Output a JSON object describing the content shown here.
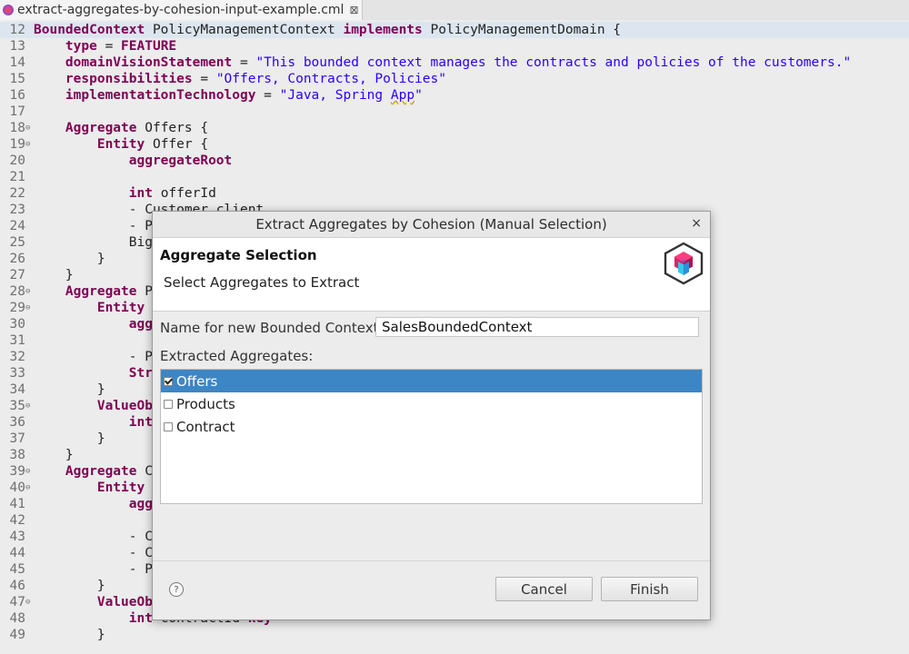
{
  "editor": {
    "tab_title": "extract-aggregates-by-cohesion-input-example.cml",
    "tab_close": "⊠",
    "lines": [
      {
        "n": "12",
        "fold": "",
        "hl": true,
        "parts": [
          [
            "kw",
            "BoundedContext"
          ],
          [
            "",
            " PolicyManagementContext "
          ],
          [
            "kw",
            "implements"
          ],
          [
            "",
            " PolicyManagementDomain {"
          ]
        ]
      },
      {
        "n": "13",
        "fold": "",
        "parts": [
          [
            "",
            "    "
          ],
          [
            "kw",
            "type"
          ],
          [
            "",
            " = "
          ],
          [
            "kw",
            "FEATURE"
          ]
        ]
      },
      {
        "n": "14",
        "fold": "",
        "parts": [
          [
            "",
            "    "
          ],
          [
            "kw",
            "domainVisionStatement"
          ],
          [
            "",
            " = "
          ],
          [
            "str",
            "\"This bounded context manages the contracts and policies of the customers.\""
          ]
        ]
      },
      {
        "n": "15",
        "fold": "",
        "parts": [
          [
            "",
            "    "
          ],
          [
            "kw",
            "responsibilities"
          ],
          [
            "",
            " = "
          ],
          [
            "str",
            "\"Offers, Contracts, Policies\""
          ]
        ]
      },
      {
        "n": "16",
        "fold": "",
        "parts": [
          [
            "",
            "    "
          ],
          [
            "kw",
            "implementationTechnology"
          ],
          [
            "",
            " = "
          ],
          [
            "str",
            "\"Java, Spring "
          ],
          [
            "str err",
            "App"
          ],
          [
            "str",
            "\""
          ]
        ]
      },
      {
        "n": "17",
        "fold": "",
        "parts": []
      },
      {
        "n": "18",
        "fold": "⊖",
        "parts": [
          [
            "",
            "    "
          ],
          [
            "kw",
            "Aggregate"
          ],
          [
            "",
            " Offers {"
          ]
        ]
      },
      {
        "n": "19",
        "fold": "⊖",
        "parts": [
          [
            "",
            "        "
          ],
          [
            "kw",
            "Entity"
          ],
          [
            "",
            " Offer {"
          ]
        ]
      },
      {
        "n": "20",
        "fold": "",
        "parts": [
          [
            "",
            "            "
          ],
          [
            "kw",
            "aggregateRoot"
          ]
        ]
      },
      {
        "n": "21",
        "fold": "",
        "parts": []
      },
      {
        "n": "22",
        "fold": "",
        "parts": [
          [
            "",
            "            "
          ],
          [
            "kw",
            "int"
          ],
          [
            "",
            " offerId"
          ]
        ]
      },
      {
        "n": "23",
        "fold": "",
        "parts": [
          [
            "",
            "            - Customer client"
          ]
        ]
      },
      {
        "n": "24",
        "fold": "",
        "parts": [
          [
            "",
            "            - P"
          ]
        ]
      },
      {
        "n": "25",
        "fold": "",
        "parts": [
          [
            "",
            "            Big"
          ]
        ]
      },
      {
        "n": "26",
        "fold": "",
        "parts": [
          [
            "",
            "        }"
          ]
        ]
      },
      {
        "n": "27",
        "fold": "",
        "parts": [
          [
            "",
            "    }"
          ]
        ]
      },
      {
        "n": "28",
        "fold": "⊖",
        "parts": [
          [
            "",
            "    "
          ],
          [
            "kw",
            "Aggregate"
          ],
          [
            "",
            " P"
          ]
        ]
      },
      {
        "n": "29",
        "fold": "⊖",
        "parts": [
          [
            "",
            "        "
          ],
          [
            "kw",
            "Entity"
          ]
        ]
      },
      {
        "n": "30",
        "fold": "",
        "parts": [
          [
            "",
            "            "
          ],
          [
            "kw",
            "agg"
          ]
        ]
      },
      {
        "n": "31",
        "fold": "",
        "parts": []
      },
      {
        "n": "32",
        "fold": "",
        "parts": [
          [
            "",
            "            - P"
          ]
        ]
      },
      {
        "n": "33",
        "fold": "",
        "parts": [
          [
            "",
            "            "
          ],
          [
            "kw",
            "Str"
          ]
        ]
      },
      {
        "n": "34",
        "fold": "",
        "parts": [
          [
            "",
            "        }"
          ]
        ]
      },
      {
        "n": "35",
        "fold": "⊖",
        "parts": [
          [
            "",
            "        "
          ],
          [
            "kw",
            "ValueOb"
          ]
        ]
      },
      {
        "n": "36",
        "fold": "",
        "parts": [
          [
            "",
            "            "
          ],
          [
            "kw",
            "int"
          ]
        ]
      },
      {
        "n": "37",
        "fold": "",
        "parts": [
          [
            "",
            "        }"
          ]
        ]
      },
      {
        "n": "38",
        "fold": "",
        "parts": [
          [
            "",
            "    }"
          ]
        ]
      },
      {
        "n": "39",
        "fold": "⊖",
        "parts": [
          [
            "",
            "    "
          ],
          [
            "kw",
            "Aggregate"
          ],
          [
            "",
            " C"
          ]
        ]
      },
      {
        "n": "40",
        "fold": "⊖",
        "parts": [
          [
            "",
            "        "
          ],
          [
            "kw",
            "Entity"
          ]
        ]
      },
      {
        "n": "41",
        "fold": "",
        "parts": [
          [
            "",
            "            "
          ],
          [
            "kw",
            "agg"
          ]
        ]
      },
      {
        "n": "42",
        "fold": "",
        "parts": []
      },
      {
        "n": "43",
        "fold": "",
        "parts": [
          [
            "",
            "            - C"
          ]
        ]
      },
      {
        "n": "44",
        "fold": "",
        "parts": [
          [
            "",
            "            - C"
          ]
        ]
      },
      {
        "n": "45",
        "fold": "",
        "parts": [
          [
            "",
            "            - P"
          ]
        ]
      },
      {
        "n": "46",
        "fold": "",
        "parts": [
          [
            "",
            "        }"
          ]
        ]
      },
      {
        "n": "47",
        "fold": "⊖",
        "parts": [
          [
            "",
            "        "
          ],
          [
            "kw",
            "ValueOb"
          ]
        ]
      },
      {
        "n": "48",
        "fold": "",
        "parts": [
          [
            "",
            "            "
          ],
          [
            "kw",
            "int"
          ],
          [
            "",
            " contractId "
          ],
          [
            "kw",
            "key"
          ]
        ]
      },
      {
        "n": "49",
        "fold": "",
        "parts": [
          [
            "",
            "        }"
          ]
        ]
      }
    ]
  },
  "dialog": {
    "title": "Extract Aggregates by Cohesion (Manual Selection)",
    "close_glyph": "×",
    "header_title": "Aggregate Selection",
    "header_description": "Select Aggregates to Extract",
    "logo_icon": "context-mapper-cube-icon",
    "name_label": "Name for new Bounded Context:",
    "name_value": "SalesBoundedContext",
    "list_label": "Extracted Aggregates:",
    "aggregates": [
      {
        "label": "Offers",
        "checked": true,
        "selected": true
      },
      {
        "label": "Products",
        "checked": false,
        "selected": false
      },
      {
        "label": "Contract",
        "checked": false,
        "selected": false
      }
    ],
    "help_glyph": "?",
    "cancel_label": "Cancel",
    "finish_label": "Finish"
  },
  "colors": {
    "selection": "#3d86c6",
    "keyword": "#7f0055",
    "string": "#2a00ff"
  }
}
